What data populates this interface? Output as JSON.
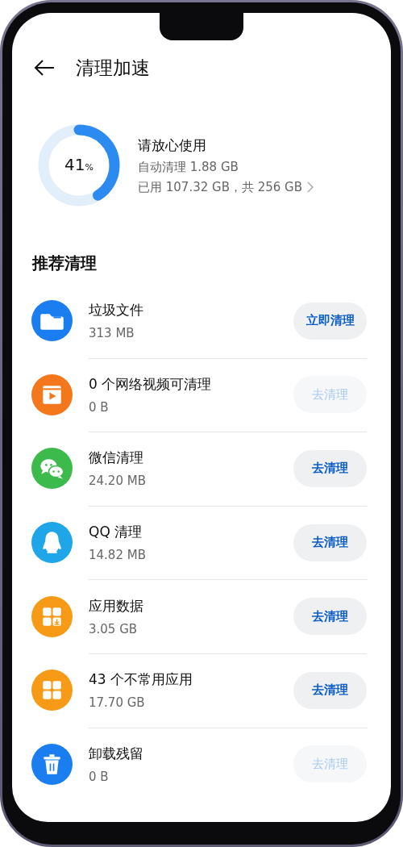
{
  "header": {
    "title": "清理加速"
  },
  "storage": {
    "level": 0.41,
    "percent": "41",
    "unit": "%",
    "status": "请放心使用",
    "auto_clean": "自动清理 1.88 GB",
    "usage": "已用 107.32 GB，共 256 GB"
  },
  "section_title": "推荐清理",
  "items": [
    {
      "kind": "folder",
      "color": "#1a7ef0",
      "title": "垃圾文件",
      "size": "313 MB",
      "action": "立即清理",
      "disabled": false
    },
    {
      "kind": "video",
      "color": "#f4771b",
      "title": "0 个网络视频可清理",
      "size": "0 B",
      "action": "去清理",
      "disabled": true
    },
    {
      "kind": "chat",
      "color": "#3cbb4c",
      "title": "微信清理",
      "size": "24.20 MB",
      "action": "去清理",
      "disabled": false
    },
    {
      "kind": "penguin",
      "color": "#1ea6e8",
      "title": "QQ 清理",
      "size": "14.82 MB",
      "action": "去清理",
      "disabled": false
    },
    {
      "kind": "appdata",
      "color": "#f69a17",
      "title": "应用数据",
      "size": "3.05 GB",
      "action": "去清理",
      "disabled": false
    },
    {
      "kind": "apps",
      "color": "#f69a17",
      "title": "43 个不常用应用",
      "size": "17.70 GB",
      "action": "去清理",
      "disabled": false
    },
    {
      "kind": "trash",
      "color": "#1a7ef0",
      "title": "卸载残留",
      "size": "0 B",
      "action": "去清理",
      "disabled": true
    }
  ]
}
